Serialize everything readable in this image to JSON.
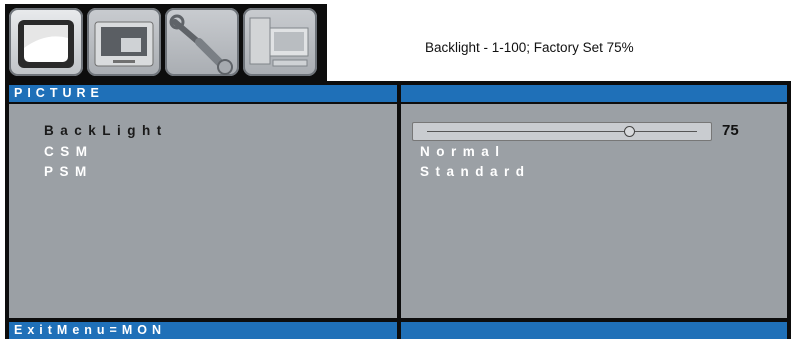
{
  "tabs": [
    {
      "name": "picture-tv-icon",
      "active": true
    },
    {
      "name": "monitor-icon",
      "active": false
    },
    {
      "name": "wrench-tools-icon",
      "active": false
    },
    {
      "name": "computer-icon",
      "active": false
    }
  ],
  "description": "Backlight - 1-100; Factory Set 75%",
  "header": {
    "title": "PICTURE",
    "right": ""
  },
  "menu": [
    {
      "label": "BackLight",
      "selected": true
    },
    {
      "label": "CSM",
      "selected": false
    },
    {
      "label": "PSM",
      "selected": false
    }
  ],
  "values": {
    "backlight": 75,
    "backlight_display": "75",
    "backlight_range": [
      1,
      100
    ],
    "csm": "Normal",
    "psm": "Standard"
  },
  "footer": {
    "hint": "ExitMenu=MON",
    "right": ""
  },
  "colors": {
    "accent": "#1f70b8",
    "panel": "#9ba0a5",
    "frame": "#0d0d0d"
  }
}
